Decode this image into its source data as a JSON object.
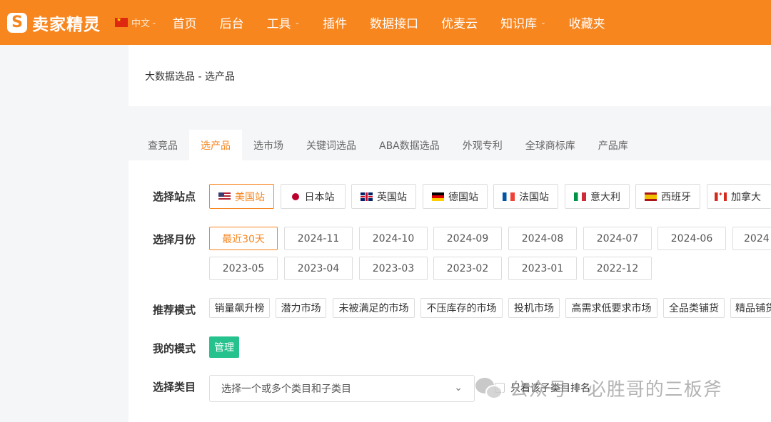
{
  "header": {
    "logo_mark": "S",
    "logo_text": "卖家精灵",
    "language": "中文",
    "nav": [
      {
        "label": "首页",
        "dropdown": false
      },
      {
        "label": "后台",
        "dropdown": false
      },
      {
        "label": "工具",
        "dropdown": true
      },
      {
        "label": "插件",
        "dropdown": false
      },
      {
        "label": "数据接口",
        "dropdown": false
      },
      {
        "label": "优麦云",
        "dropdown": false
      },
      {
        "label": "知识库",
        "dropdown": true
      },
      {
        "label": "收藏夹",
        "dropdown": false
      }
    ]
  },
  "breadcrumb": "大数据选品 - 选产品",
  "tabs": [
    {
      "label": "查竞品",
      "active": false
    },
    {
      "label": "选产品",
      "active": true
    },
    {
      "label": "选市场",
      "active": false
    },
    {
      "label": "关键词选品",
      "active": false
    },
    {
      "label": "ABA数据选品",
      "active": false
    },
    {
      "label": "外观专利",
      "active": false
    },
    {
      "label": "全球商标库",
      "active": false
    },
    {
      "label": "产品库",
      "active": false
    }
  ],
  "filters": {
    "site_label": "选择站点",
    "sites": [
      {
        "label": "美国站",
        "flag": "us",
        "active": true
      },
      {
        "label": "日本站",
        "flag": "jp",
        "active": false
      },
      {
        "label": "英国站",
        "flag": "gb",
        "active": false
      },
      {
        "label": "德国站",
        "flag": "de",
        "active": false
      },
      {
        "label": "法国站",
        "flag": "fr",
        "active": false
      },
      {
        "label": "意大利",
        "flag": "it",
        "active": false
      },
      {
        "label": "西班牙",
        "flag": "es",
        "active": false
      },
      {
        "label": "加拿大",
        "flag": "ca",
        "active": false
      }
    ],
    "month_label": "选择月份",
    "months": [
      "最近30天",
      "2024-11",
      "2024-10",
      "2024-09",
      "2024-08",
      "2024-07",
      "2024-06",
      "2024",
      "2023-05",
      "2023-04",
      "2023-03",
      "2023-02",
      "2023-01",
      "2022-12"
    ],
    "mode_label": "推荐模式",
    "modes": [
      "销量飙升榜",
      "潜力市场",
      "未被满足的市场",
      "不压库存的市场",
      "投机市场",
      "高需求低要求市场",
      "全品类铺货",
      "精品铺货"
    ],
    "my_mode_label": "我的模式",
    "manage_label": "管理",
    "category_label": "选择类目",
    "category_placeholder": "选择一个或多个类目和子类目",
    "checkbox_label": "只看该子类目排名"
  },
  "watermark": "公众号 · 必胜哥的三板斧",
  "colors": {
    "brand": "#f7861f",
    "manage": "#25c28e"
  }
}
